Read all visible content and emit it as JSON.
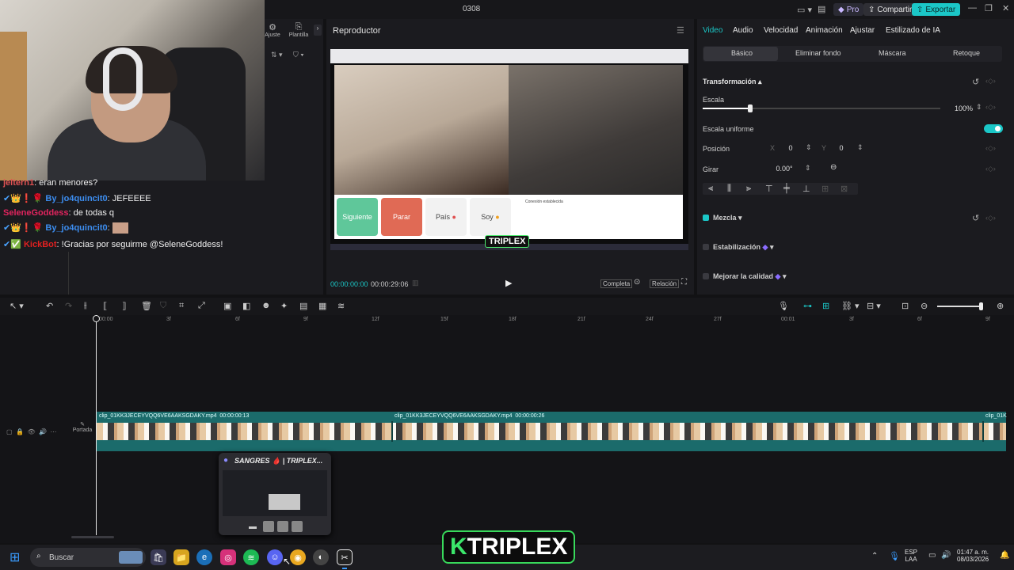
{
  "titlebar": {
    "title": "0308",
    "pro_label": "Pro",
    "share_label": "Compartir",
    "export_label": "Exportar",
    "accent": "#1bc7c7"
  },
  "left_toolbar": {
    "adjust_label": "Ajuste",
    "templates_label": "Plantilla"
  },
  "chat": {
    "messages": [
      {
        "user": "jeltern1",
        "text": ": eran menores?",
        "color": "#e05252"
      },
      {
        "user": "By_jo4quincit0",
        "text": ": JEFEEEE",
        "color": "#3c8df0"
      },
      {
        "user": "SeleneGoddess",
        "text": ": de todas q",
        "color": "#e0245e"
      },
      {
        "user": "By_jo4quincit0",
        "text": ":",
        "color": "#3c8df0"
      },
      {
        "user": "KickBot",
        "text": ": !Gracias por seguirme @SeleneGoddess!",
        "color": "#e02020"
      }
    ]
  },
  "player": {
    "header": "Reproductor",
    "current_time": "00:00:00:00",
    "total_time": "00:00:29:06",
    "full_label": "Completa",
    "ratio_label": "Relación",
    "buttons": [
      {
        "label": "Siguiente",
        "bg": "#5fc79a"
      },
      {
        "label": "Parar",
        "bg": "#e06a55"
      },
      {
        "label": "País",
        "bg": "#f2f2f2"
      },
      {
        "label": "Soy",
        "bg": "#f2f2f2"
      }
    ],
    "chat_notice": "Conexión establecida",
    "overlay_logo": "TRIPLEX"
  },
  "props": {
    "tabs": [
      "Video",
      "Audio",
      "Velocidad",
      "Animación",
      "Ajustar",
      "Estilizado de IA"
    ],
    "subtabs": [
      "Básico",
      "Eliminar fondo",
      "Máscara",
      "Retoque"
    ],
    "transform_label": "Transformación",
    "scale_label": "Escala",
    "scale_value": "100%",
    "scale_fraction": 0.2,
    "uniform_label": "Escala uniforme",
    "position_label": "Posición",
    "pos_x_label": "X",
    "pos_x": "0",
    "pos_y_label": "Y",
    "pos_y": "0",
    "rotate_label": "Girar",
    "rotate_value": "0.00°",
    "blend_label": "Mezcla",
    "stabilize_label": "Estabilización",
    "enhance_label": "Mejorar la calidad"
  },
  "timeline": {
    "ticks": [
      "00:00",
      "3f",
      "6f",
      "9f",
      "12f",
      "15f",
      "18f",
      "21f",
      "24f",
      "27f",
      "00:01",
      "3f",
      "6f",
      "9f"
    ],
    "cover_label": "Portada",
    "clips": [
      {
        "name": "clip_01KK3JECEYVQQ6VE6AAKSGDAKY.mp4",
        "duration": "00:00:00:13"
      },
      {
        "name": "clip_01KK3JECEYVQQ6VE6AAKSGDAKY.mp4",
        "duration": "00:00:00:26"
      },
      {
        "name": "clip_01K",
        "duration": ""
      }
    ]
  },
  "popup": {
    "title": "SANGRES 🩸 | TRIPLEX..."
  },
  "taskbar": {
    "search_placeholder": "Buscar",
    "lang": "ESP",
    "lang2": "LAA",
    "time": "01:47 a. m.",
    "date": "08/03/2026"
  },
  "watermark": {
    "k": "K",
    "rest": "TRIPLEX"
  }
}
